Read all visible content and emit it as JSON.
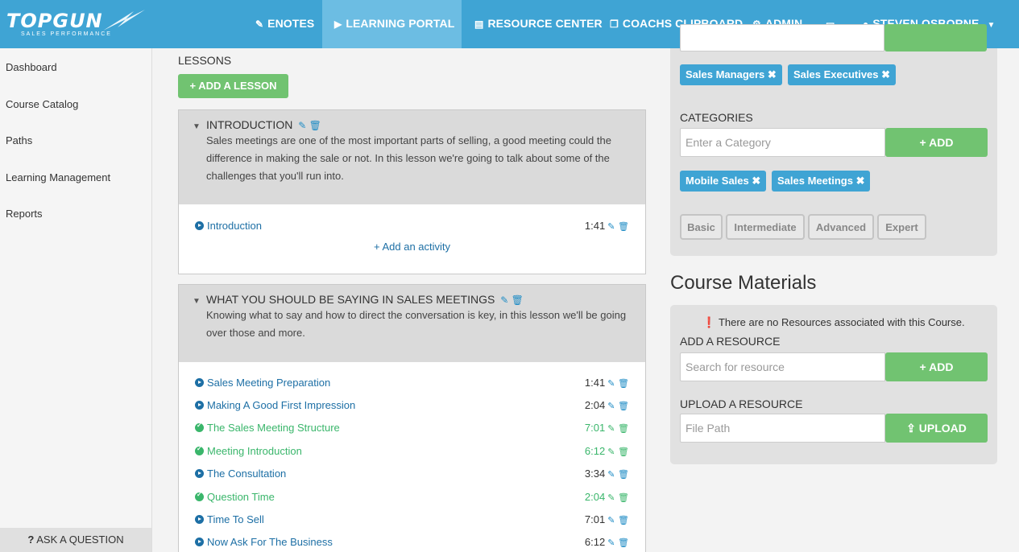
{
  "nav": {
    "logo_brand": "TOPGUN",
    "logo_sub": "SALES PERFORMANCE",
    "items": [
      {
        "label": "ENOTES",
        "icon": "pencil-icon"
      },
      {
        "label": "LEARNING PORTAL",
        "icon": "play-circle-icon"
      },
      {
        "label": "RESOURCE CENTER",
        "icon": "document-icon"
      },
      {
        "label": "COACHS CLIPBOARD",
        "icon": "clipboard-icon"
      },
      {
        "label": "ADMIN",
        "icon": "gears-icon"
      },
      {
        "label": "",
        "icon": "inbox-icon"
      },
      {
        "label": "STEVEN OSBORNE",
        "icon": "user-icon"
      }
    ]
  },
  "sidebar": {
    "items": [
      "Dashboard",
      "Course Catalog",
      "Paths",
      "Learning Management",
      "Reports"
    ],
    "ask": "ASK A QUESTION"
  },
  "lessons": {
    "heading": "LESSONS",
    "add_label": "ADD A LESSON",
    "add_activity": "Add an activity",
    "list": [
      {
        "title": "INTRODUCTION",
        "description": "Sales meetings are one of the most important parts of selling, a good meeting could the difference in making the sale or not. In this lesson we're going to talk about some of the challenges that you'll run into.",
        "activities": [
          {
            "name": "Introduction",
            "time": "1:41",
            "done": false
          }
        ]
      },
      {
        "title": "WHAT YOU SHOULD BE SAYING IN SALES MEETINGS",
        "description": "Knowing what to say and how to direct the conversation is key, in this lesson we'll be going over those and more.",
        "activities": [
          {
            "name": "Sales Meeting Preparation",
            "time": "1:41",
            "done": false
          },
          {
            "name": "Making A Good First Impression",
            "time": "2:04",
            "done": false
          },
          {
            "name": "The Sales Meeting Structure",
            "time": "7:01",
            "done": true
          },
          {
            "name": "Meeting Introduction",
            "time": "6:12",
            "done": true
          },
          {
            "name": "The Consultation",
            "time": "3:34",
            "done": false
          },
          {
            "name": "Question Time",
            "time": "2:04",
            "done": true
          },
          {
            "name": "Time To Sell",
            "time": "7:01",
            "done": false
          },
          {
            "name": "Now Ask For The Business",
            "time": "6:12",
            "done": false
          }
        ]
      }
    ]
  },
  "audience_tags": [
    "Sales Managers",
    "Sales Executives"
  ],
  "categories": {
    "label": "CATEGORIES",
    "placeholder": "Enter a Category",
    "add_label": "ADD",
    "tags": [
      "Mobile Sales",
      "Sales Meetings"
    ]
  },
  "levels": [
    "Basic",
    "Intermediate",
    "Advanced",
    "Expert"
  ],
  "course_materials": {
    "title": "Course Materials",
    "notice": "There are no Resources associated with this Course.",
    "add_resource_label": "ADD A RESOURCE",
    "search_placeholder": "Search for resource",
    "add_label": "ADD",
    "upload_label": "UPLOAD A RESOURCE",
    "file_placeholder": "File Path",
    "upload_button": "UPLOAD"
  },
  "colors": {
    "primary": "#3fa4d4",
    "green": "#71c371",
    "done": "#3ab66b",
    "link": "#1d6fa5"
  }
}
